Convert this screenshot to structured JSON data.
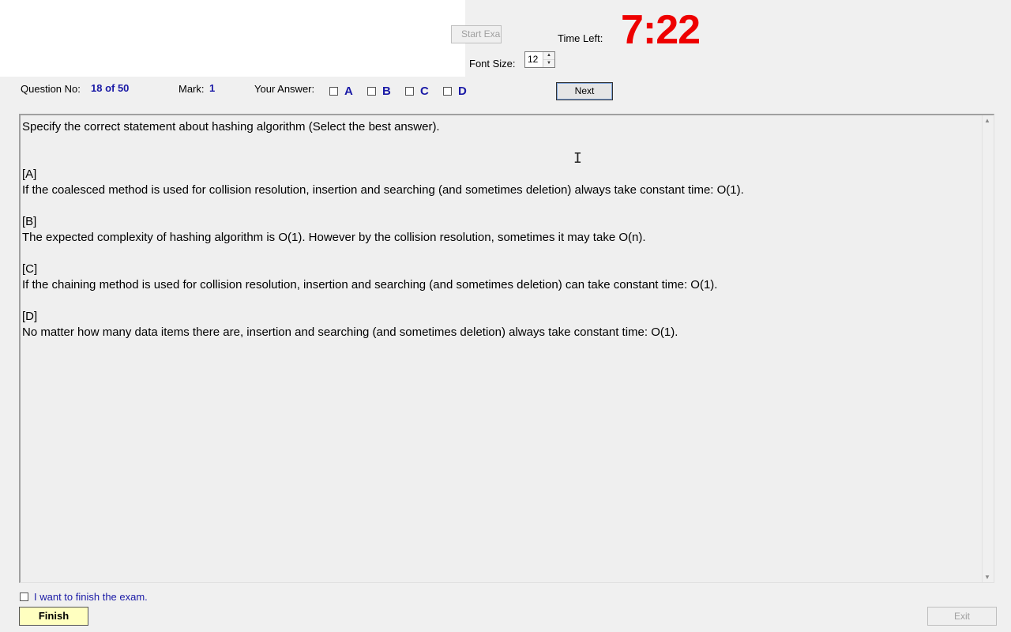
{
  "header": {
    "start_exam_label": "Start Exam",
    "timer_label": "Time Left:",
    "timer_value": "7:22",
    "timer_color": "#ee0000",
    "font_size_label": "Font Size:",
    "font_size_value": "12"
  },
  "question_bar": {
    "question_no_label": "Question No:",
    "question_no_value": "18 of 50",
    "mark_label": "Mark:",
    "mark_value": "1",
    "your_answer_label": "Your Answer:",
    "options": [
      "A",
      "B",
      "C",
      "D"
    ],
    "next_label": "Next"
  },
  "question": {
    "prompt": "Specify the correct statement about hashing algorithm (Select the best answer).",
    "answers": [
      {
        "tag": "[A]",
        "text": "If the coalesced method is used for collision resolution,  insertion and searching (and sometimes deletion) always take constant time: O(1)."
      },
      {
        "tag": "[B]",
        "text": "The expected complexity of hashing algorithm is O(1). However by the collision resolution, sometimes it may take O(n)."
      },
      {
        "tag": "[C]",
        "text": "If the chaining method is used for collision resolution,  insertion and searching (and sometimes deletion) can take constant time: O(1)."
      },
      {
        "tag": "[D]",
        "text": "No matter how many data items there are, insertion and searching (and sometimes deletion) always take constant time: O(1)."
      }
    ]
  },
  "footer": {
    "finish_checkbox_label": "I want to finish the exam.",
    "finish_label": "Finish",
    "exit_label": "Exit"
  },
  "colors": {
    "accent_blue": "#1a1aa6",
    "finish_button_bg": "#ffffc0",
    "background": "#f0f0f0"
  }
}
